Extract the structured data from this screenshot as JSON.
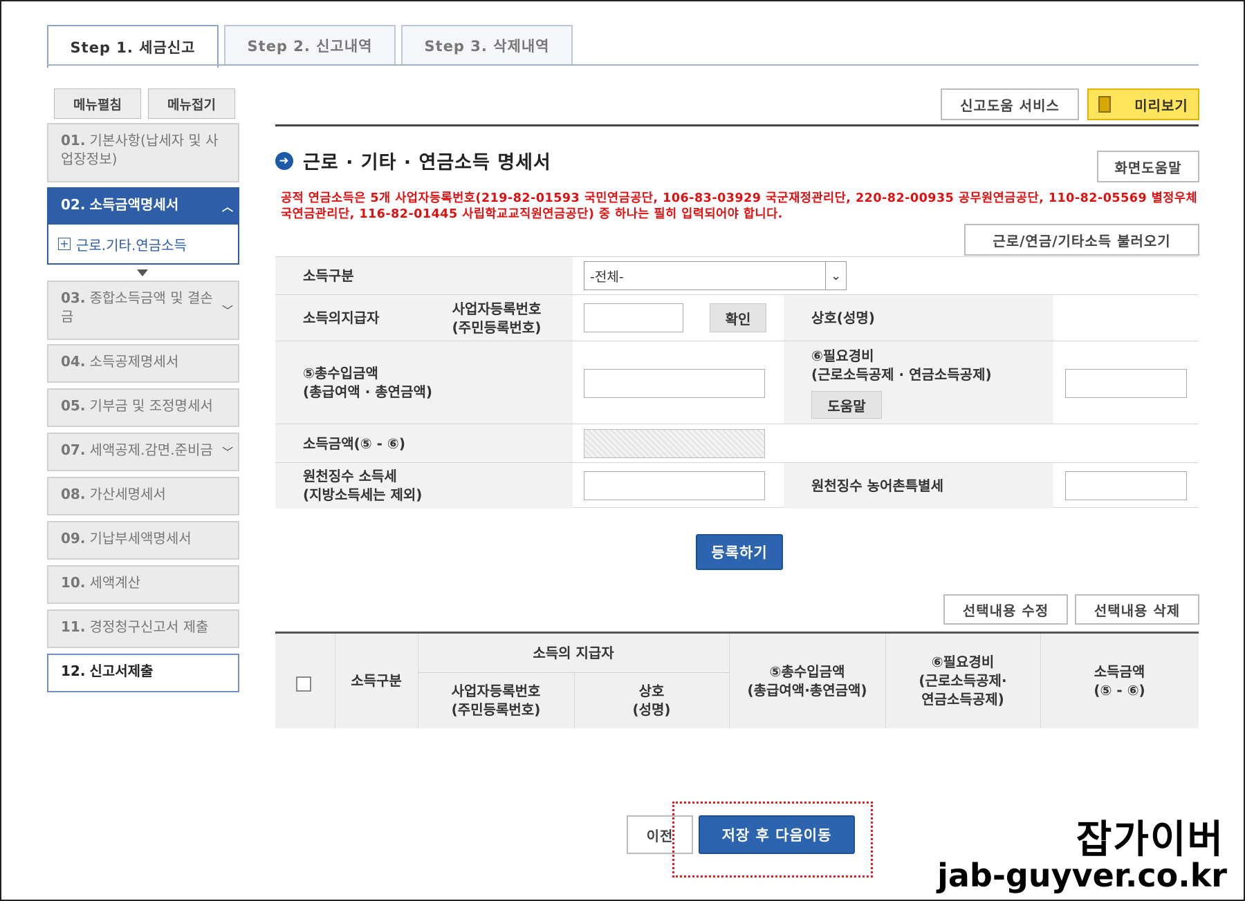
{
  "tabs": [
    "Step 1. 세금신고",
    "Step 2. 신고내역",
    "Step 3. 삭제내역"
  ],
  "sidebar": {
    "edit_btn": "메뉴펼침",
    "collapse_btn": "메뉴접기",
    "items": [
      {
        "num": "01.",
        "label": "기본사항(납세자 및 사업장정보)"
      },
      {
        "num": "02.",
        "label": "소득금액명세서"
      },
      {
        "num": "03.",
        "label": "종합소득금액 및 결손금"
      },
      {
        "num": "04.",
        "label": "소득공제명세서"
      },
      {
        "num": "05.",
        "label": "기부금 및 조정명세서"
      },
      {
        "num": "07.",
        "label": "세액공제.감면.준비금"
      },
      {
        "num": "08.",
        "label": "가산세명세서"
      },
      {
        "num": "09.",
        "label": "기납부세액명세서"
      },
      {
        "num": "10.",
        "label": "세액계산"
      },
      {
        "num": "11.",
        "label": "경정청구신고서 제출"
      },
      {
        "num": "12.",
        "label": "신고서제출"
      }
    ],
    "sub_item": "근로.기타.연금소득"
  },
  "header": {
    "help_service": "신고도움 서비스",
    "preview": "미리보기",
    "title": "근로 · 기타 · 연금소득 명세서",
    "screen_help": "화면도움말",
    "notice": "공적 연금소득은 5개 사업자등록번호(219-82-01593 국민연금공단, 106-83-03929 국군재정관리단, 220-82-00935 공무원연금공단, 110-82-05569 별정우체국연금관리단, 116-82-01445 사립학교교직원연금공단) 중 하나는 필히 입력되어야 합니다.",
    "load_btn": "근로/연금/기타소득 불러오기"
  },
  "form": {
    "income_type_label": "소득구분",
    "income_type_value": "-전체-",
    "payer_label": "소득의지급자",
    "biz_no_label": "사업자등록번호\n(주민등록번호)",
    "confirm_btn": "확인",
    "company_label": "상호(성명)",
    "total_income_label": "⑤총수입금액\n(총급여액 · 총연금액)",
    "expense_label": "⑥필요경비\n(근로소득공제 · 연금소득공제)",
    "help_btn": "도움말",
    "income_amount_label": "소득금액(⑤ - ⑥)",
    "withholding_label": "원천징수 소득세\n(지방소득세는 제외)",
    "rural_tax_label": "원천징수 농어촌특별세",
    "register_btn": "등록하기"
  },
  "list": {
    "edit_btn": "선택내용 수정",
    "delete_btn": "선택내용 삭제",
    "col_type": "소득구분",
    "col_payer": "소득의 지급자",
    "col_biz_no": "사업자등록번호\n(주민등록번호)",
    "col_company": "상호\n(성명)",
    "col_total": "⑤총수입금액\n(총급여액·총연금액)",
    "col_expense": "⑥필요경비\n(근로소득공제·\n연금소득공제)",
    "col_amount": "소득금액\n(⑤ - ⑥)"
  },
  "footer": {
    "prev_btn": "이전",
    "save_next_btn": "저장 후 다음이동"
  },
  "watermark": {
    "name": "잡가이버",
    "url": "jab-guyver.co.kr"
  }
}
